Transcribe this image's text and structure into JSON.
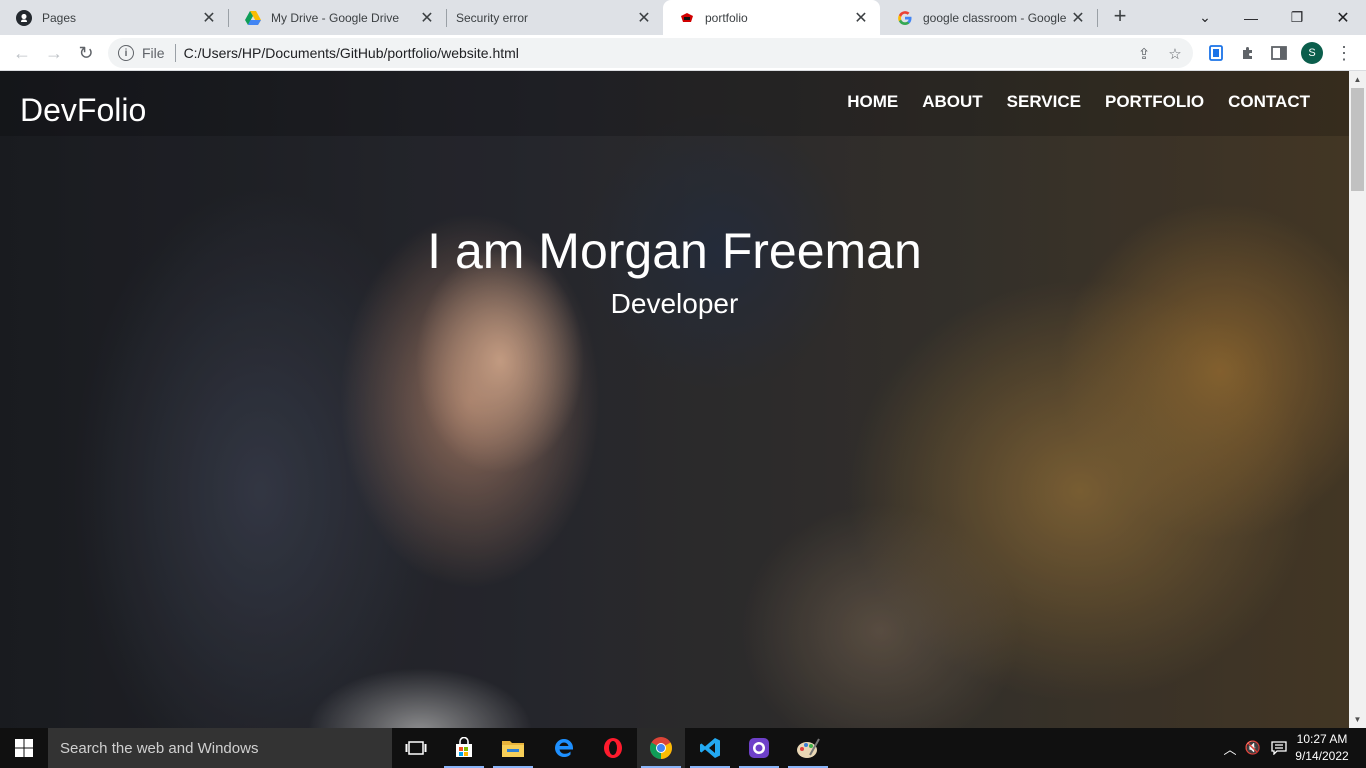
{
  "browser": {
    "tabs": [
      {
        "title": "Pages",
        "icon": "github-icon"
      },
      {
        "title": "My Drive - Google Drive",
        "icon": "google-drive-icon"
      },
      {
        "title": "Security error",
        "icon": "none"
      },
      {
        "title": "portfolio",
        "icon": "portfolio-favicon",
        "active": true
      },
      {
        "title": "google classroom - Google S",
        "icon": "google-icon"
      }
    ],
    "address": {
      "scheme_label": "File",
      "url": "C:/Users/HP/Documents/GitHub/portfolio/website.html"
    },
    "profile_initial": "S"
  },
  "page": {
    "brand": "DevFolio",
    "nav": [
      "HOME",
      "ABOUT",
      "SERVICE",
      "PORTFOLIO",
      "CONTACT"
    ],
    "hero_title": "I am Morgan Freeman",
    "hero_subtitle": "Developer"
  },
  "taskbar": {
    "search_placeholder": "Search the web and Windows",
    "apps": [
      "task-view-icon",
      "store-icon",
      "file-explorer-icon",
      "edge-icon",
      "opera-icon",
      "chrome-icon",
      "vscode-icon",
      "github-desktop-icon",
      "paint-icon"
    ],
    "time": "10:27 AM",
    "date": "9/14/2022"
  }
}
